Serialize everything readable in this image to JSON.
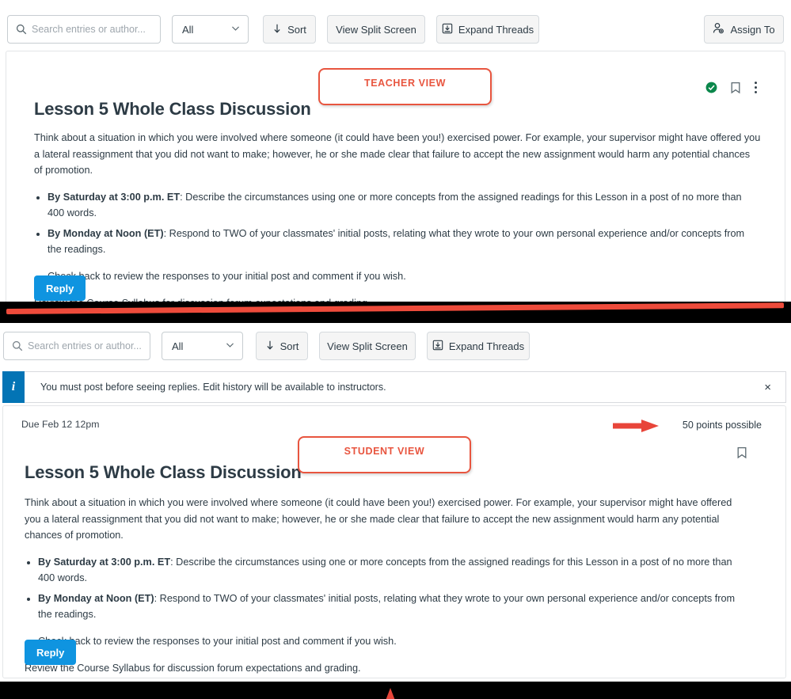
{
  "toolbar": {
    "search_placeholder": "Search entries or author...",
    "search_value": "",
    "search_icon": "search-icon",
    "filter_selected": "All",
    "filter_options": [
      "All"
    ],
    "chevron_icon": "chevron-down-icon",
    "sort_label": "Sort",
    "sort_icon": "arrow-down-icon",
    "split_screen_label": "View Split Screen",
    "expand_threads_label": "Expand Threads",
    "expand_threads_icon": "expand-down-box-icon",
    "assign_to_label": "Assign To",
    "assign_to_icon": "user-add-icon"
  },
  "teacher_panel": {
    "annotation": "TEACHER VIEW",
    "title": "Lesson 5 Whole Class Discussion",
    "status_icon": "checkmark-circle-icon",
    "bookmark_icon": "bookmark-icon",
    "more_icon": "kebab-menu-icon",
    "reply_label": "Reply"
  },
  "student_panel": {
    "annotation": "STUDENT VIEW",
    "due_date": "Due Feb 12 12pm",
    "points": "50 points possible",
    "title": "Lesson 5 Whole Class Discussion",
    "bookmark_icon": "bookmark-icon",
    "arrow_icon": "red-right-arrow-icon",
    "reply_label": "Reply"
  },
  "alert": {
    "icon": "info-icon",
    "message": "You must post before seeing replies. Edit history will be available to instructors.",
    "close_icon": "close-icon",
    "close_label": "×"
  },
  "discussion": {
    "paragraph": "Think about a situation in which you were involved where someone (it could have been you!) exercised power. For example, your supervisor might have offered you a lateral reassignment that you did not want to make; however, he or she made clear that failure to accept the new assignment would harm any potential chances of promotion.",
    "bullets": [
      {
        "lead": "By Saturday at 3:00 p.m. ET",
        "rest": ": Describe the circumstances using one or more concepts from the assigned readings for this Lesson in a post of no more than 400 words."
      },
      {
        "lead": "By Monday at Noon (ET)",
        "rest": ": Respond to TWO of your classmates' initial posts, relating what they wrote to your own personal experience and/or concepts from the readings."
      }
    ],
    "bullet_last": "Check back to review the responses to your initial post and comment if you wish.",
    "closing": "Review the Course Syllabus for discussion forum expectations and grading."
  },
  "colors": {
    "annotation_red": "#e8553f",
    "arrow_red": "#e8453a",
    "reply_blue": "#0f94e0",
    "info_blue": "#0374b5",
    "status_green": "#0b874b",
    "text": "#2d3b45"
  }
}
